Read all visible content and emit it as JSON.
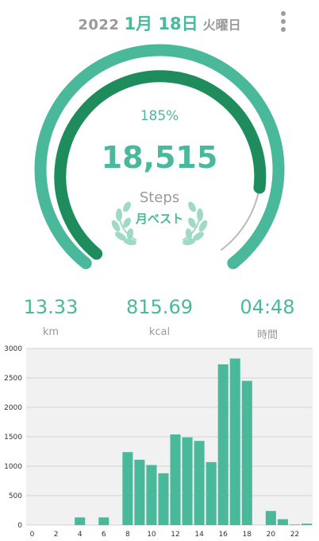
{
  "header": {
    "year": "2022",
    "monthday": "1月 18日",
    "weekday": "火曜日",
    "menu_icon": "more-vertical-icon"
  },
  "progress": {
    "percent_text": "185%",
    "percent_value": 1.85,
    "steps": "18,515",
    "steps_label": "Steps",
    "badge": "月ベスト",
    "badge_icon": "laurel-wreath-icon"
  },
  "stats": [
    {
      "value": "13.33",
      "unit": "km"
    },
    {
      "value": "815.69",
      "unit": "kcal"
    },
    {
      "value": "04:48",
      "unit": "時間"
    }
  ],
  "colors": {
    "accent": "#4ab99b",
    "accent_dark": "#1f8c5e",
    "text_gray": "#9a9a9a",
    "chart_bg": "#f1f1f1",
    "bar": "#4ab99b"
  },
  "chart_data": {
    "type": "bar",
    "x": [
      0,
      1,
      2,
      3,
      4,
      5,
      6,
      7,
      8,
      9,
      10,
      11,
      12,
      13,
      14,
      15,
      16,
      17,
      18,
      19,
      20,
      21,
      22,
      23
    ],
    "values": [
      0,
      0,
      0,
      0,
      130,
      0,
      130,
      0,
      1240,
      1110,
      1020,
      880,
      1540,
      1490,
      1430,
      1070,
      2730,
      2830,
      2450,
      0,
      240,
      100,
      10,
      25
    ],
    "xticks": [
      0,
      2,
      4,
      6,
      8,
      10,
      12,
      14,
      16,
      18,
      20,
      22
    ],
    "yticks": [
      0,
      500,
      1000,
      1500,
      2000,
      2500,
      3000
    ],
    "ylim": [
      0,
      3000
    ],
    "grid": true,
    "xlabel": "",
    "ylabel": ""
  }
}
